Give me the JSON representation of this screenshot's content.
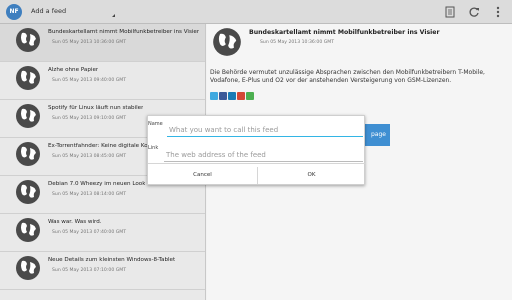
{
  "app": {
    "icon_label": "NF",
    "add_feed_label": "Add a feed"
  },
  "toolbar_icons": [
    "newspaper-icon",
    "refresh-icon",
    "overflow-menu-icon"
  ],
  "feed_items": [
    {
      "title": "Bundeskartellamt nimmt Mobilfunkbetreiber ins Visier",
      "date": "Sun 05 May 2013 10:36:00 GMT"
    },
    {
      "title": "Alzhe ohne Papier",
      "date": "Sun 05 May 2013 09:40:00 GMT"
    },
    {
      "title": "Spotify für Linux läuft nun stabiler",
      "date": "Sun 05 May 2013 09:10:00 GMT"
    },
    {
      "title": "Ex-Torrentfahnder: Keine digitale Konkurrenz",
      "date": "Sun 05 May 2013 08:45:00 GMT"
    },
    {
      "title": "Debian 7.0 Wheezy im neuen Look",
      "date": "Sun 05 May 2013 08:14:00 GMT"
    },
    {
      "title": "Was war. Was wird.",
      "date": "Sun 05 May 2013 07:40:00 GMT"
    },
    {
      "title": "Neue Details zum kleinsten Windows-8-Tablet",
      "date": "Sun 05 May 2013 07:10:00 GMT"
    }
  ],
  "detail": {
    "title": "Bundeskartellamt nimmt Mobilfunkbetreiber ins Visier",
    "date": "Sun 05 May 2013 10:36:00 GMT",
    "text": "Die Behörde vermutet unzulässige Absprachen zwischen den Mobilfunkbetreibern T-Mobile, Vodafone, E-Plus und O2 vor der anstehenden Versteigerung von GSM-Lizenzen.",
    "share_icons": [
      "twitter-icon",
      "facebook-icon",
      "linkedin-icon",
      "google-plus-icon",
      "email-icon"
    ],
    "page_button_label": "page"
  },
  "dialog": {
    "name_label": "Name",
    "name_placeholder": "What you want to call this feed",
    "name_value": "",
    "link_label": "Link",
    "link_placeholder": "The web address of the feed",
    "link_value": "",
    "cancel_label": "Cancel",
    "ok_label": "OK"
  },
  "colors": {
    "accent": "#33b5e5",
    "button_blue": "#3f8fd2",
    "twitter": "#3fa9e0",
    "facebook": "#3b5998",
    "linkedin": "#1a7bb5",
    "googleplus": "#d34836",
    "email": "#4caf50"
  }
}
